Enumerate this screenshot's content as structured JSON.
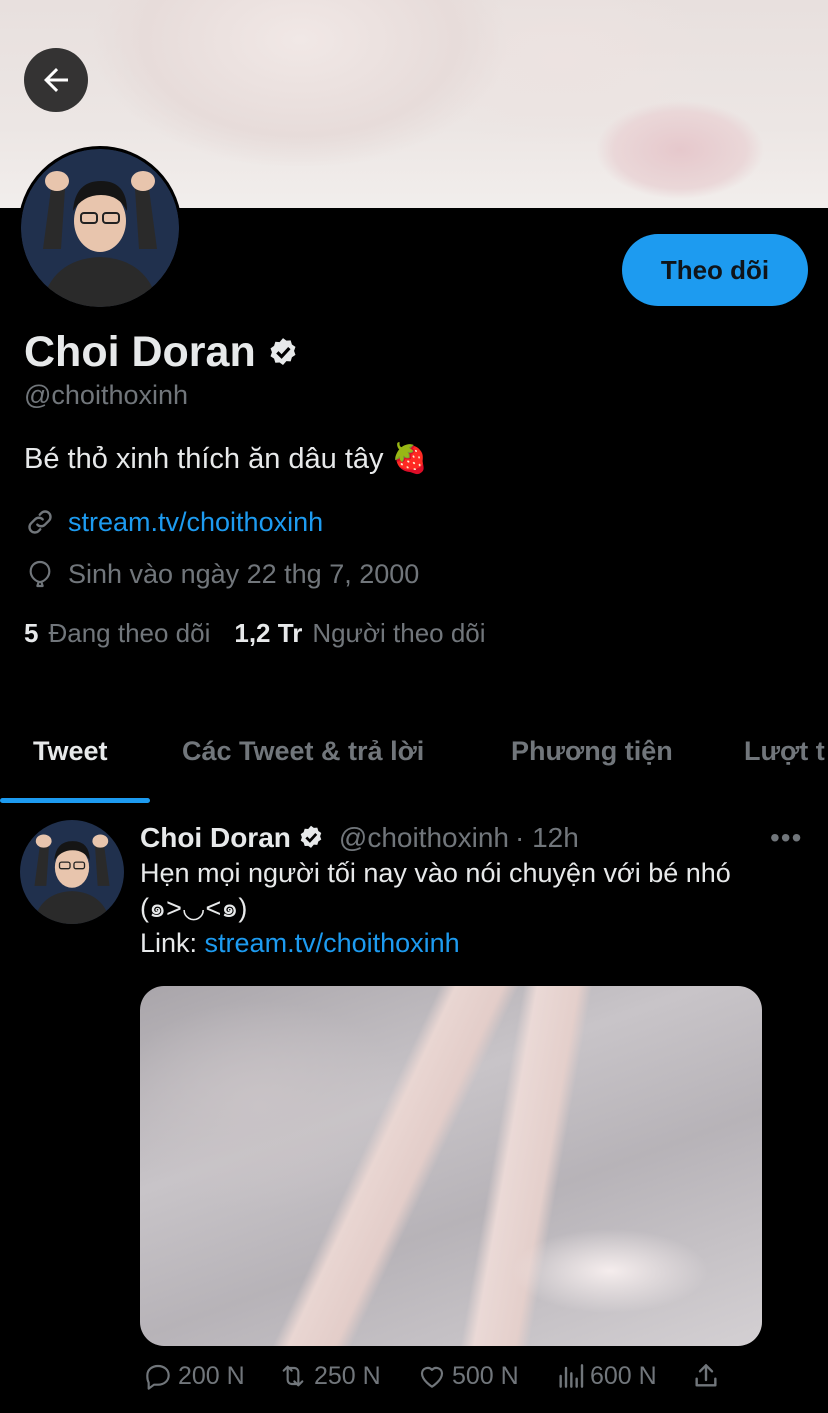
{
  "header": {
    "back_label": "Back"
  },
  "profile": {
    "follow_label": "Theo dõi",
    "name": "Choi Doran",
    "handle": "@choithoxinh",
    "bio": "Bé thỏ xinh thích ăn dâu tây 🍓",
    "link": "stream.tv/choithoxinh",
    "birthday": "Sinh vào ngày 22 thg 7, 2000",
    "following_count": "5",
    "following_label": "Đang theo dõi",
    "followers_count": "1,2 Tr",
    "followers_label": "Người theo dõi"
  },
  "tabs": [
    {
      "label": "Tweet",
      "active": true
    },
    {
      "label": "Các Tweet & trả lời"
    },
    {
      "label": "Phương tiện"
    },
    {
      "label": "Lượt t"
    }
  ],
  "tweet": {
    "name": "Choi Doran",
    "handle": "@choithoxinh",
    "time": "· 12h",
    "more": "•••",
    "text_line1": "Hẹn mọi người tối nay vào nói chuyện với bé nhó",
    "text_line2": "(๑>◡<๑)",
    "link_prefix": "Link: ",
    "link": "stream.tv/choithoxinh",
    "replies": "200 N",
    "retweets": "250 N",
    "likes": "500 N",
    "views": "600 N"
  },
  "colors": {
    "accent": "#1d9bf0",
    "background": "#000000",
    "secondary_text": "#71767b"
  }
}
